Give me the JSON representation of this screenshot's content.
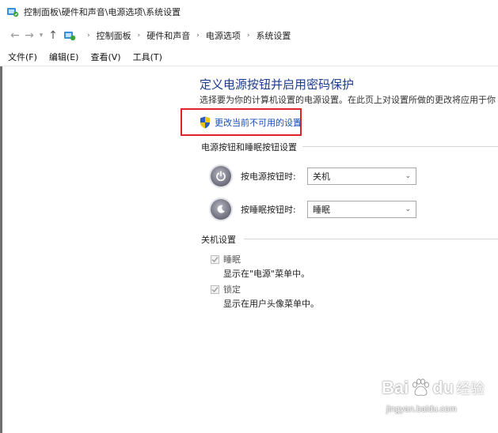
{
  "window": {
    "title": "控制面板\\硬件和声音\\电源选项\\系统设置"
  },
  "navigation": {
    "back_icon": "back-arrow-icon",
    "forward_icon": "forward-arrow-icon",
    "recent_icon": "chevron-down-icon",
    "up_icon": "up-arrow-icon",
    "breadcrumbs": [
      "控制面板",
      "硬件和声音",
      "电源选项",
      "系统设置"
    ]
  },
  "menu": {
    "items": [
      "文件(F)",
      "编辑(E)",
      "查看(V)",
      "工具(T)"
    ]
  },
  "main": {
    "heading": "定义电源按钮并启用密码保护",
    "description": "选择要为你的计算机设置的电源设置。在此页上对设置所做的更改将应用于你",
    "change_link": "更改当前不可用的设置",
    "power_section": {
      "title": "电源按钮和睡眠按钮设置",
      "rows": [
        {
          "label": "按电源按钮时:",
          "value": "关机"
        },
        {
          "label": "按睡眠按钮时:",
          "value": "睡眠"
        }
      ]
    },
    "shutdown_section": {
      "title": "关机设置",
      "options": [
        {
          "label": "睡眠",
          "checked": true,
          "description": "显示在\"电源\"菜单中。"
        },
        {
          "label": "锁定",
          "checked": true,
          "description": "显示在用户头像菜单中。"
        }
      ]
    }
  },
  "watermark": {
    "bai": "Bai",
    "du": "du",
    "jingyan": "经验",
    "url": "jingyan.baidu.com"
  },
  "colors": {
    "heading": "#1e3d8f",
    "link": "#1a4fb8",
    "highlight_box": "#e0222b"
  }
}
